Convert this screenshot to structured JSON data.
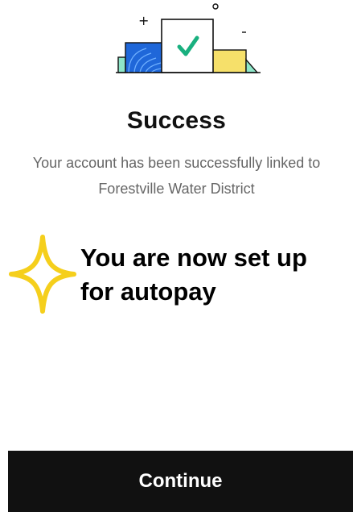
{
  "illustration": {
    "icon": "linked-account-success-icon",
    "colors": {
      "blue_panel": "#1f67d9",
      "blue_lines": "#6fb0ff",
      "yellow_panel": "#f6e06a",
      "green_accent": "#8ee6c9",
      "check": "#19b07f",
      "outline": "#111111"
    }
  },
  "success": {
    "title": "Success",
    "message": "Your account has been successfully linked to Forestville Water District"
  },
  "annotation": {
    "text": "You are now set up for autopay",
    "icon": "sparkle-icon",
    "color": "#f5cf1c"
  },
  "footer": {
    "continue_label": "Continue"
  }
}
